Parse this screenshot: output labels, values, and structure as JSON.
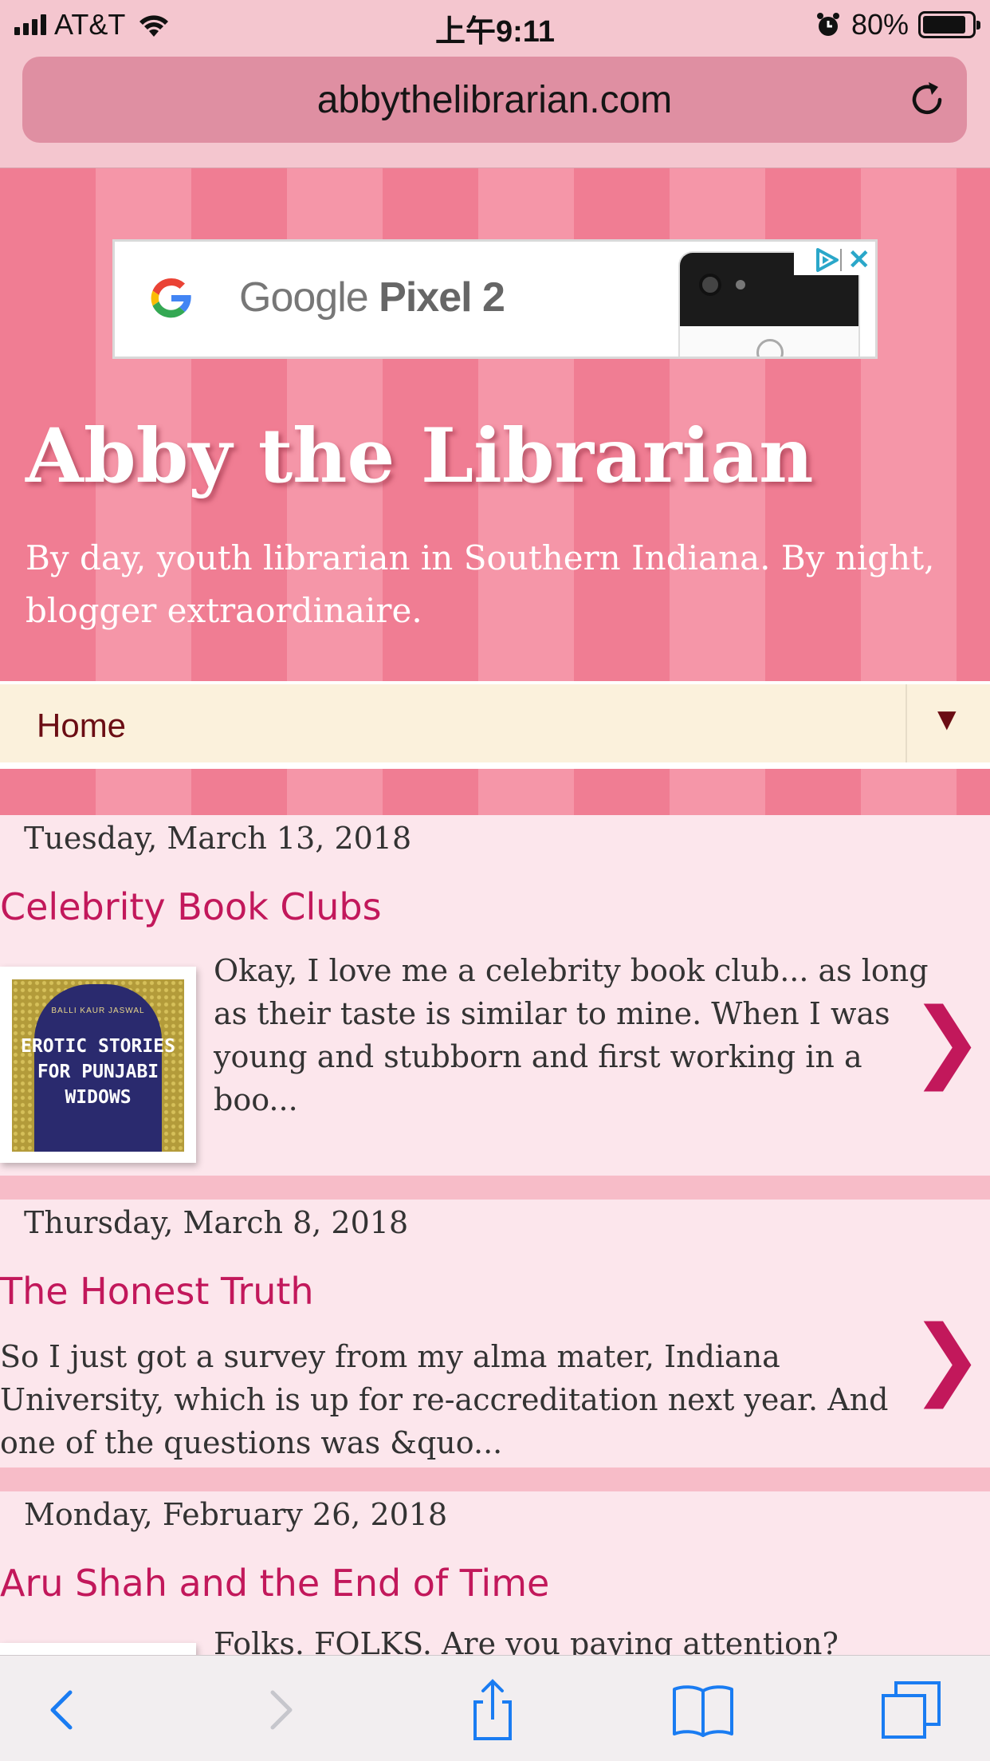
{
  "status_bar": {
    "carrier": "AT&T",
    "time": "上午9:11",
    "battery": "80%"
  },
  "browser": {
    "url": "abbythelibrarian.com"
  },
  "ad": {
    "brand": "Google",
    "product": "Pixel 2"
  },
  "blog": {
    "title": "Abby the Librarian",
    "description": "By day, youth librarian in Southern Indiana. By night, blogger extraordinaire."
  },
  "nav": {
    "home_label": "Home",
    "toggle_glyph": "▼"
  },
  "posts": [
    {
      "date": "Tuesday, March 13, 2018",
      "title": "Celebrity Book Clubs",
      "excerpt": "Okay, I love me a celebrity book club... as long as their taste is similar to mine. When I was young and stubborn and first working in a boo...",
      "thumbnail_text": "EROTIC STORIES FOR PUNJABI WIDOWS",
      "thumbnail_author": "BALLI KAUR JASWAL"
    },
    {
      "date": "Thursday, March 8, 2018",
      "title": "The Honest Truth",
      "excerpt": "So I just got a survey from my alma mater, Indiana University, which is up for re-accreditation next year. And one of the questions was &quo..."
    },
    {
      "date": "Monday, February 26, 2018",
      "title": "Aru Shah and the End of Time",
      "excerpt": "Folks. FOLKS. Are you paying attention?"
    }
  ],
  "icons": {
    "post_arrow": "❯"
  },
  "colors": {
    "header_stripe_a": "#f07d93",
    "header_stripe_b": "#f596a8",
    "post_title": "#c2185b",
    "nav_bg": "#fbf1dc",
    "nav_text": "#6b0d14"
  }
}
